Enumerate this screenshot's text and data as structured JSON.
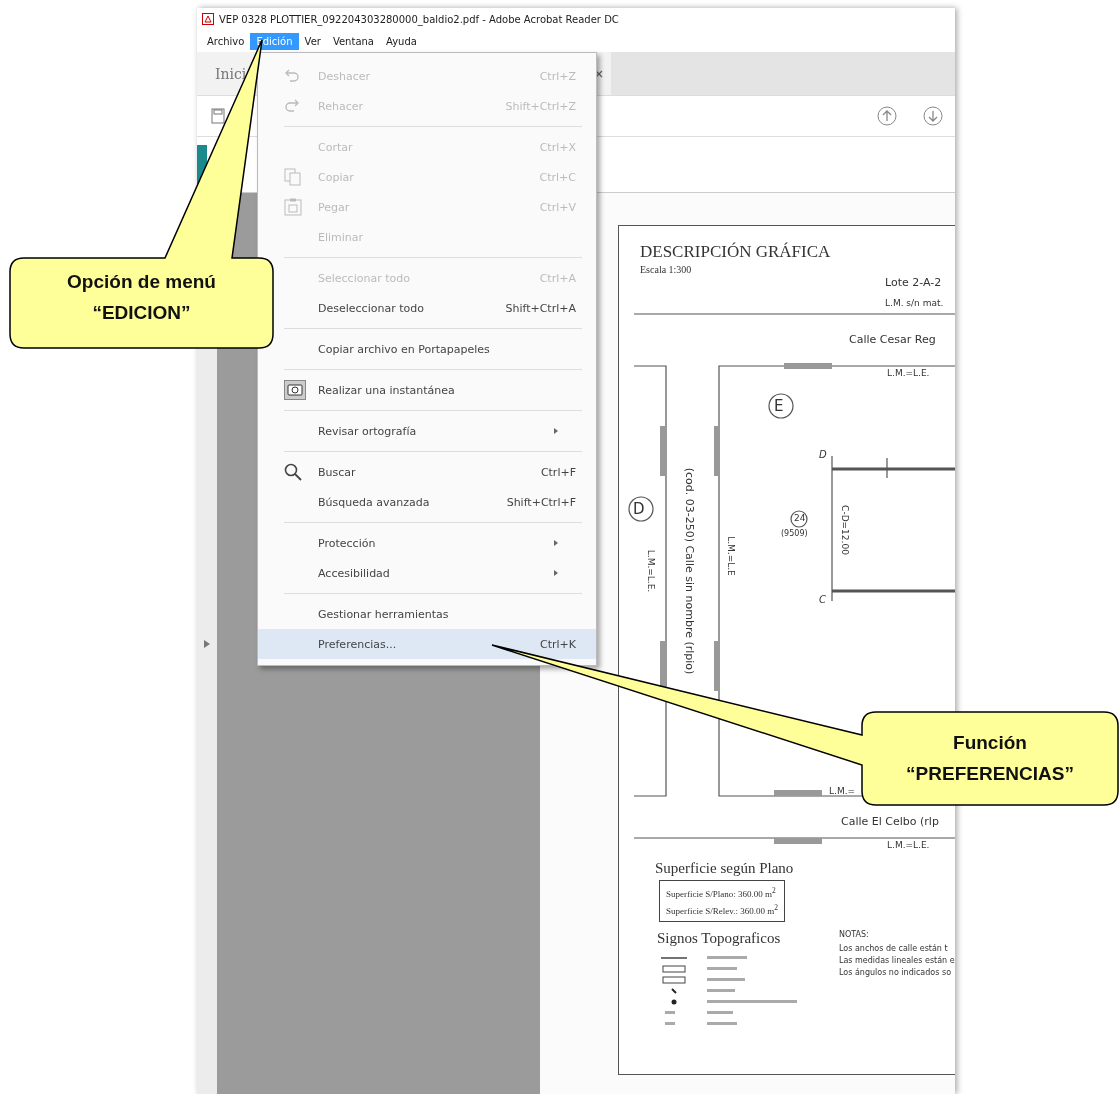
{
  "window": {
    "title": "VEP 0328 PLOTTIER_092204303280000_baldio2.pdf - Adobe Acrobat Reader DC"
  },
  "menu_bar": [
    {
      "label": "Archivo",
      "selected": false
    },
    {
      "label": "Edición",
      "selected": true
    },
    {
      "label": "Ver",
      "selected": false
    },
    {
      "label": "Ventana",
      "selected": false
    },
    {
      "label": "Ayuda",
      "selected": false
    }
  ],
  "tabs": [
    {
      "label": "Inici"
    }
  ],
  "edit_menu": [
    {
      "kind": "item",
      "label": "Deshacer",
      "shortcut": "Ctrl+Z",
      "disabled": true,
      "submenu": false,
      "selected": false
    },
    {
      "kind": "item",
      "label": "Rehacer",
      "shortcut": "Shift+Ctrl+Z",
      "disabled": true,
      "submenu": false,
      "selected": false
    },
    {
      "kind": "separator"
    },
    {
      "kind": "item",
      "label": "Cortar",
      "shortcut": "Ctrl+X",
      "disabled": true,
      "submenu": false,
      "selected": false
    },
    {
      "kind": "item",
      "label": "Copiar",
      "shortcut": "Ctrl+C",
      "disabled": true,
      "submenu": false,
      "selected": false
    },
    {
      "kind": "item",
      "label": "Pegar",
      "shortcut": "Ctrl+V",
      "disabled": true,
      "submenu": false,
      "selected": false
    },
    {
      "kind": "item",
      "label": "Eliminar",
      "disabled": true,
      "submenu": false,
      "selected": false
    },
    {
      "kind": "separator"
    },
    {
      "kind": "item",
      "label": "Seleccionar todo",
      "shortcut": "Ctrl+A",
      "disabled": true,
      "submenu": false,
      "selected": false
    },
    {
      "kind": "item",
      "label": "Deseleccionar todo",
      "shortcut": "Shift+Ctrl+A",
      "disabled": false,
      "submenu": false,
      "selected": false
    },
    {
      "kind": "separator"
    },
    {
      "kind": "item",
      "label": "Copiar archivo en Portapapeles",
      "disabled": false,
      "submenu": false,
      "selected": false
    },
    {
      "kind": "separator"
    },
    {
      "kind": "item",
      "label": "Realizar una instantánea",
      "disabled": false,
      "submenu": false,
      "selected": false
    },
    {
      "kind": "separator"
    },
    {
      "kind": "item",
      "label": "Revisar ortografía",
      "disabled": false,
      "submenu": true,
      "selected": false
    },
    {
      "kind": "separator"
    },
    {
      "kind": "item",
      "label": "Buscar",
      "shortcut": "Ctrl+F",
      "disabled": false,
      "submenu": false,
      "selected": false
    },
    {
      "kind": "item",
      "label": "Búsqueda avanzada",
      "shortcut": "Shift+Ctrl+F",
      "disabled": false,
      "submenu": false,
      "selected": false
    },
    {
      "kind": "separator"
    },
    {
      "kind": "item",
      "label": "Protección",
      "disabled": false,
      "submenu": true,
      "selected": false
    },
    {
      "kind": "item",
      "label": "Accesibilidad",
      "disabled": false,
      "submenu": true,
      "selected": false
    },
    {
      "kind": "separator"
    },
    {
      "kind": "item",
      "label": "Gestionar herramientas",
      "disabled": false,
      "submenu": false,
      "selected": false
    },
    {
      "kind": "item",
      "label": "Preferencias...",
      "shortcut": "Ctrl+K",
      "disabled": false,
      "submenu": false,
      "selected": true
    }
  ],
  "plan": {
    "heading": "DESCRIPCIÓN GRÁFICA",
    "scale": "Escala 1:300",
    "lot": "Lote 2-A-2",
    "lot_note": "L.M. s/n mat.",
    "street_north": "Calle Cesar Reg",
    "north_line": "L.M.=L.E.",
    "block_east": "E",
    "block_west": "D",
    "street_west": "(cod. 03-250) Calle sin nombre (rlpio)",
    "west_line_left": "L.M.=L.E.",
    "west_line_right": "L.M.=L.E",
    "vertex_top": "D",
    "vertex_bottom": "C",
    "side_length": "C-D=12.00",
    "parcel_number": "24",
    "parcel_code": "(9509)",
    "south_line_inner": "L.M.=",
    "street_south": "Calle El Celbo (rlp",
    "south_line": "L.M.=L.E."
  },
  "surface": {
    "title": "Superficie según Plano",
    "lines": [
      "Superficie S/Plano: 360.00 m$^{2}$",
      "Superficie S/Relev.: 360.00 m$^{2}$"
    ]
  },
  "legend": {
    "title": "Signos Topograficos"
  },
  "notes": {
    "title": "NOTAS:",
    "lines": [
      "Los anchos de calle están t",
      "Las medidas lineales están e",
      "Los ángulos no indicados so"
    ]
  },
  "callouts": [
    {
      "lines": [
        "Opción de menú",
        "“EDICION”"
      ]
    },
    {
      "lines": [
        "Función",
        "“PREFERENCIAS”"
      ]
    }
  ]
}
